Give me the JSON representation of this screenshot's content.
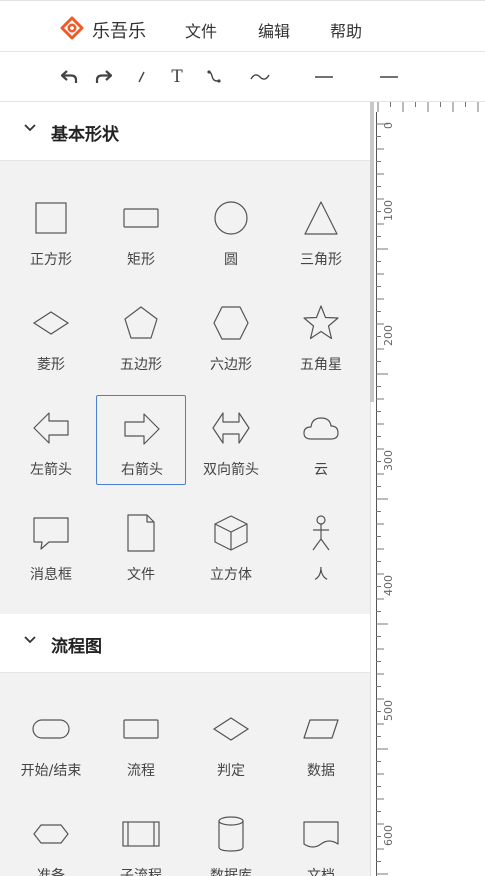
{
  "app": {
    "title": "乐吾乐",
    "brand_color": "#f05a28"
  },
  "menu": [
    {
      "label": "文件"
    },
    {
      "label": "编辑"
    },
    {
      "label": "帮助"
    }
  ],
  "toolbar": {
    "tools": [
      "undo-icon",
      "redo-icon",
      "line-icon",
      "text-icon",
      "curve-connector-icon",
      "wave-line-icon",
      "dash-line-icon",
      "straight-line-icon"
    ],
    "text_tool_label": "T"
  },
  "sections": [
    {
      "title": "基本形状",
      "shapes": [
        {
          "label": "正方形",
          "icon": "square-icon"
        },
        {
          "label": "矩形",
          "icon": "rectangle-icon"
        },
        {
          "label": "圆",
          "icon": "circle-icon"
        },
        {
          "label": "三角形",
          "icon": "triangle-icon"
        },
        {
          "label": "菱形",
          "icon": "diamond-icon"
        },
        {
          "label": "五边形",
          "icon": "pentagon-icon"
        },
        {
          "label": "六边形",
          "icon": "hexagon-icon"
        },
        {
          "label": "五角星",
          "icon": "star-icon"
        },
        {
          "label": "左箭头",
          "icon": "left-arrow-icon"
        },
        {
          "label": "右箭头",
          "icon": "right-arrow-icon"
        },
        {
          "label": "双向箭头",
          "icon": "double-arrow-icon"
        },
        {
          "label": "云",
          "icon": "cloud-icon"
        },
        {
          "label": "消息框",
          "icon": "message-box-icon"
        },
        {
          "label": "文件",
          "icon": "file-icon"
        },
        {
          "label": "立方体",
          "icon": "cube-icon"
        },
        {
          "label": "人",
          "icon": "person-icon"
        }
      ]
    },
    {
      "title": "流程图",
      "shapes": [
        {
          "label": "开始/结束",
          "icon": "terminator-icon"
        },
        {
          "label": "流程",
          "icon": "process-icon"
        },
        {
          "label": "判定",
          "icon": "decision-icon"
        },
        {
          "label": "数据",
          "icon": "data-icon"
        },
        {
          "label": "准备",
          "icon": "preparation-icon"
        },
        {
          "label": "子流程",
          "icon": "subprocess-icon"
        },
        {
          "label": "数据库",
          "icon": "database-icon"
        },
        {
          "label": "文档",
          "icon": "document-icon"
        }
      ]
    }
  ],
  "selected_shape": "右箭头",
  "ruler": {
    "labels": [
      "0",
      "100",
      "200",
      "300",
      "400",
      "500",
      "600"
    ]
  },
  "colors": {
    "selection_border": "#4a7fd1",
    "panel_bg": "#f2f2f2"
  }
}
